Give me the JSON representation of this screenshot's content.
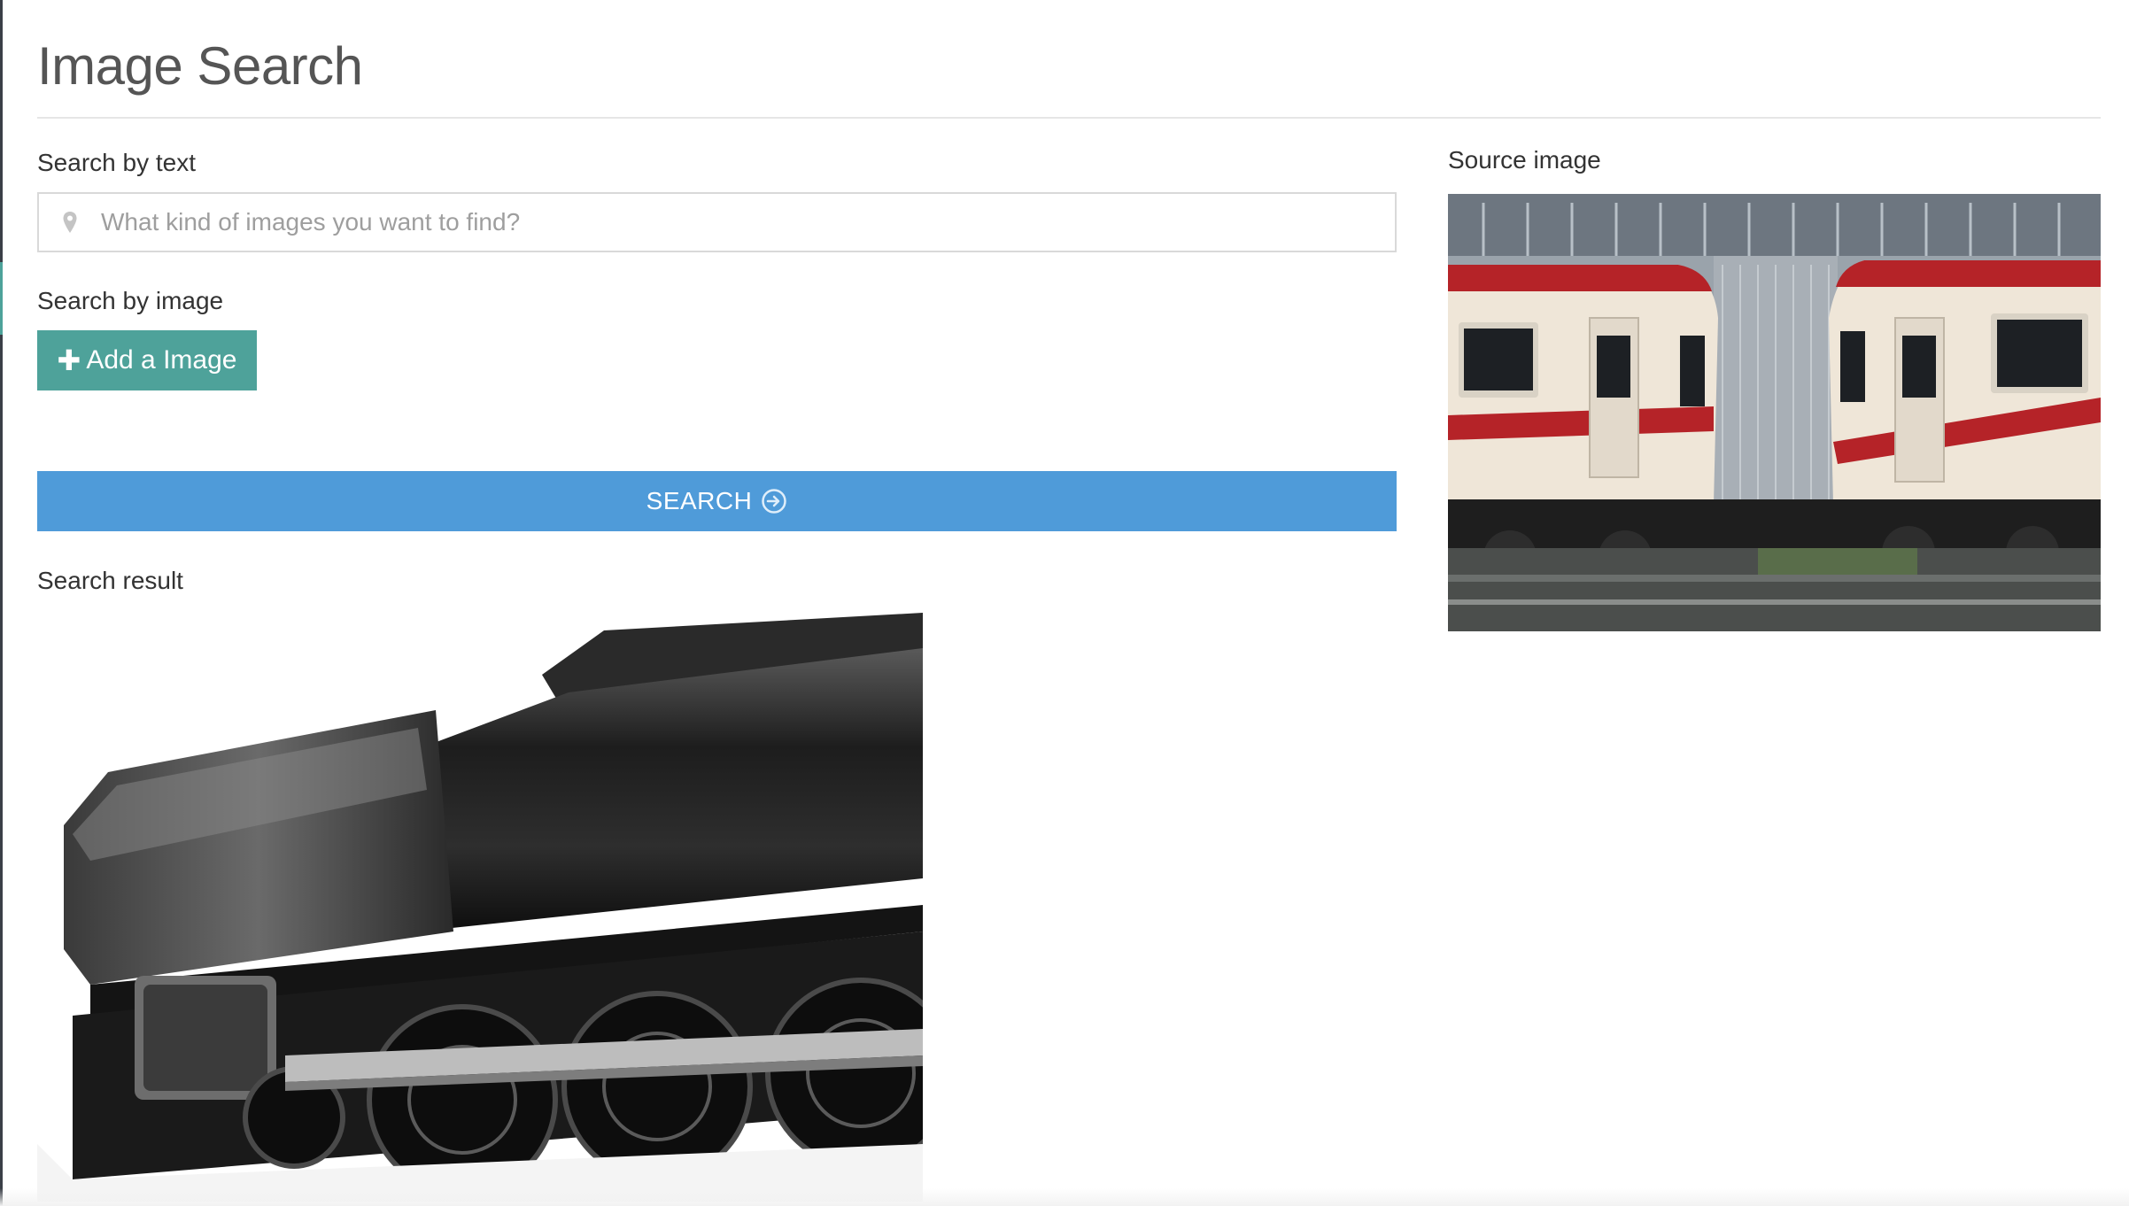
{
  "page": {
    "title": "Image Search"
  },
  "text_search": {
    "label": "Search by text",
    "placeholder": "What kind of images you want to find?",
    "value": ""
  },
  "image_search": {
    "label": "Search by image",
    "add_button_label": "Add a Image"
  },
  "search_button": {
    "label": "SEARCH"
  },
  "result": {
    "label": "Search result"
  },
  "source": {
    "label": "Source image"
  },
  "colors": {
    "accent_green": "#4ea29a",
    "accent_blue": "#4f9bd9",
    "rail": "#3a3f47"
  },
  "icons": {
    "input_icon": "map-pin-icon",
    "add_icon": "plus-icon",
    "search_icon": "circle-arrow-right-icon"
  }
}
